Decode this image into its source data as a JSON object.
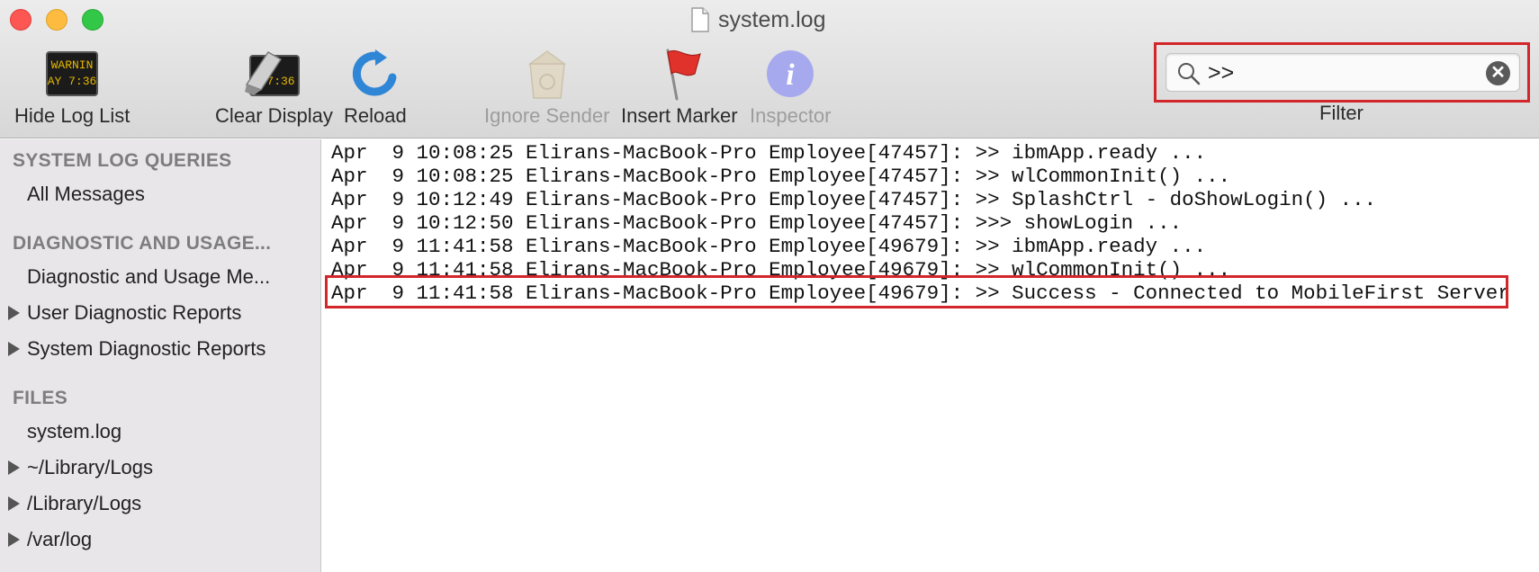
{
  "window": {
    "title": "system.log"
  },
  "toolbar": {
    "hide_log_list": "Hide Log List",
    "clear_display": "Clear Display",
    "reload": "Reload",
    "ignore_sender": "Ignore Sender",
    "insert_marker": "Insert Marker",
    "inspector": "Inspector",
    "warning_icon_text_1": "WARNIN",
    "warning_icon_text_2": "AY 7:36",
    "clear_icon_text": "7:36",
    "inspector_icon_glyph": "i"
  },
  "filter": {
    "label": "Filter",
    "value": ">>",
    "clear_glyph": "✕"
  },
  "sidebar": {
    "system_log_queries": "SYSTEM LOG QUERIES",
    "all_messages": "All Messages",
    "diagnostic_and_usage": "DIAGNOSTIC AND USAGE...",
    "diagnostic_usage_messages": "Diagnostic and Usage Me...",
    "user_diagnostic_reports": "User Diagnostic Reports",
    "system_diagnostic_reports": "System Diagnostic Reports",
    "files": "FILES",
    "system_log": "system.log",
    "user_library_logs": "~/Library/Logs",
    "library_logs": "/Library/Logs",
    "var_log": "/var/log"
  },
  "log_lines": [
    "Apr  9 10:08:25 Elirans-MacBook-Pro Employee[47457]: >> ibmApp.ready ...",
    "Apr  9 10:08:25 Elirans-MacBook-Pro Employee[47457]: >> wlCommonInit() ...",
    "Apr  9 10:12:49 Elirans-MacBook-Pro Employee[47457]: >> SplashCtrl - doShowLogin() ...",
    "Apr  9 10:12:50 Elirans-MacBook-Pro Employee[47457]: >>> showLogin ...",
    "Apr  9 11:41:58 Elirans-MacBook-Pro Employee[49679]: >> ibmApp.ready ...",
    "Apr  9 11:41:58 Elirans-MacBook-Pro Employee[49679]: >> wlCommonInit() ...",
    "Apr  9 11:41:58 Elirans-MacBook-Pro Employee[49679]: >> Success - Connected to MobileFirst Server"
  ],
  "colors": {
    "highlight_border": "#d3262a",
    "sidebar_bg": "#e8e6e8"
  }
}
